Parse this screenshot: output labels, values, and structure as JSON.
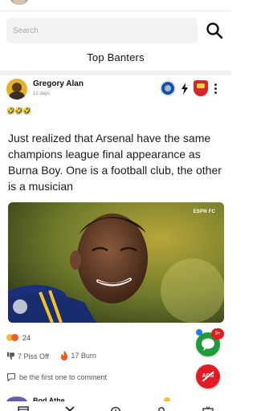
{
  "search": {
    "placeholder": "Search"
  },
  "section": {
    "title": "Top Banters"
  },
  "post": {
    "author": "Gregory Alan",
    "time": "12 days",
    "emojis": "🤣🤣🤣",
    "text": "Just realized that Arsenal have the same champions league final appearance as Burna Boy. One is a football club, the other is a musician",
    "image_watermark": "ESPN FC",
    "clubs": [
      "chelsea",
      "arsenal"
    ],
    "reaction_count": "24",
    "actions": [
      {
        "icon": "thumbs-down-icon",
        "label": "7 Piss Off"
      },
      {
        "icon": "flame-icon",
        "label": "17 Burn"
      }
    ],
    "comment_prompt": "be the first one to comment"
  },
  "next_post": {
    "author": "Bod Athe"
  },
  "fab": {
    "chat_badge": "9+",
    "ads_label": "ADS"
  },
  "colors": {
    "chat_green": "#1e9b3a",
    "alert_red": "#e31b23",
    "chelsea_blue": "#1b4fa0",
    "arsenal_red": "#d7262b"
  }
}
